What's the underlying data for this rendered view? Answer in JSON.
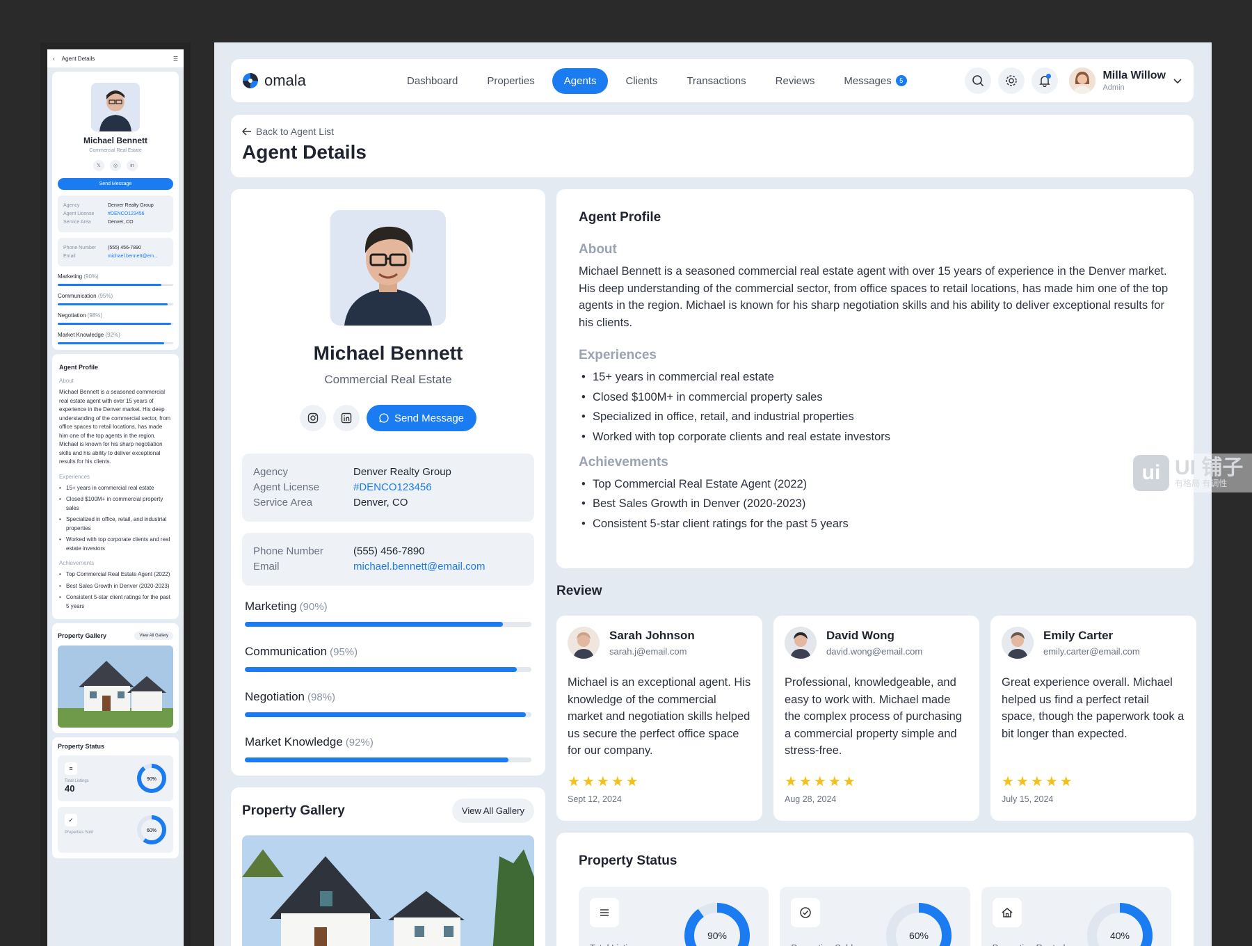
{
  "mobile": {
    "header_title": "Agent Details",
    "agent_name": "Michael Bennett",
    "agent_role": "Commercial Real Estate",
    "send_message": "Send Message",
    "info1": [
      {
        "k": "Agency",
        "v": "Denver Realty Group"
      },
      {
        "k": "Agent License",
        "v": "#DENCO123456"
      },
      {
        "k": "Service Area",
        "v": "Denver, CO"
      }
    ],
    "info2": [
      {
        "k": "Phone Number",
        "v": "(555) 456-7890"
      },
      {
        "k": "Email",
        "v": "michael.bennett@em..."
      }
    ],
    "profile_title": "Agent Profile",
    "about_title": "About",
    "experiences_title": "Experiences",
    "achievements_title": "Achievements",
    "gallery_title": "Property Gallery",
    "gallery_button": "View All Gallery",
    "status_title": "Property Status",
    "stat1_label": "Total Listings",
    "stat1_value": "40",
    "stat1_pct": "90%",
    "stat2_label": "Properties Sold",
    "stat2_pct": "60%"
  },
  "nav": {
    "brand": "omala",
    "links": [
      "Dashboard",
      "Properties",
      "Agents",
      "Clients",
      "Transactions",
      "Reviews",
      "Messages"
    ],
    "messages_badge": "5",
    "user_name": "Milla Willow",
    "user_role": "Admin"
  },
  "header": {
    "back": "Back to Agent List",
    "title": "Agent Details"
  },
  "agent": {
    "name": "Michael Bennett",
    "role": "Commercial Real Estate",
    "send_message": "Send Message",
    "agency_label": "Agency",
    "agency": "Denver Realty Group",
    "license_label": "Agent License",
    "license": "#DENCO123456",
    "area_label": "Service Area",
    "area": "Denver, CO",
    "phone_label": "Phone Number",
    "phone": "(555) 456-7890",
    "email_label": "Email",
    "email": "michael.bennett@email.com",
    "skills": [
      {
        "name": "Marketing",
        "pct_text": "(90%)",
        "value": 0.9
      },
      {
        "name": "Communication",
        "pct_text": "(95%)",
        "value": 0.95
      },
      {
        "name": "Negotiation",
        "pct_text": "(98%)",
        "value": 0.98
      },
      {
        "name": "Market Knowledge",
        "pct_text": "(92%)",
        "value": 0.92
      }
    ]
  },
  "gallery": {
    "title": "Property Gallery",
    "button": "View All Gallery"
  },
  "profile": {
    "title": "Agent Profile",
    "about_title": "About",
    "about": "Michael Bennett is a seasoned commercial real estate agent with over 15 years of experience in the Denver market. His deep understanding of the commercial sector, from office spaces to retail locations, has made him one of the top agents in the region. Michael is known for his sharp negotiation skills and his ability to deliver exceptional results for his clients.",
    "experiences_title": "Experiences",
    "experiences": [
      "15+ years in commercial real estate",
      "Closed $100M+ in commercial property sales",
      "Specialized in office, retail, and industrial properties",
      "Worked with top corporate clients and real estate investors"
    ],
    "achievements_title": "Achievements",
    "achievements": [
      "Top Commercial Real Estate Agent (2022)",
      "Best Sales Growth in Denver (2020-2023)",
      "Consistent 5-star client ratings for the past 5 years"
    ]
  },
  "reviews": {
    "title": "Review",
    "items": [
      {
        "name": "Sarah Johnson",
        "email": "sarah.j@email.com",
        "text": "Michael is an exceptional agent. His knowledge of the commercial market and negotiation skills helped us secure the perfect office space for our company.",
        "stars": 5,
        "date": "Sept 12, 2024"
      },
      {
        "name": "David Wong",
        "email": "david.wong@email.com",
        "text": "Professional, knowledgeable, and easy to work with. Michael made the complex process of purchasing a commercial property simple and stress-free.",
        "stars": 5,
        "date": "Aug 28, 2024"
      },
      {
        "name": "Emily Carter",
        "email": "emily.carter@email.com",
        "text": "Great experience overall. Michael helped us find a perfect retail space, though the paperwork took a bit longer than expected.",
        "stars": 5,
        "date": "July 15, 2024"
      }
    ]
  },
  "status": {
    "title": "Property Status",
    "cards": [
      {
        "label": "Total Listings",
        "pct_text": "90%",
        "value": 0.9,
        "icon": "list-icon"
      },
      {
        "label": "Properties Sold",
        "pct_text": "60%",
        "value": 0.6,
        "icon": "check-circle-icon"
      },
      {
        "label": "Properties Rented",
        "pct_text": "40%",
        "value": 0.4,
        "icon": "home-icon"
      }
    ]
  },
  "watermark": {
    "mark": "ui",
    "line1": "UI 铺子",
    "line2": "有格局 有调性"
  },
  "colors": {
    "accent": "#1b7cf2",
    "star": "#f5c01b"
  }
}
